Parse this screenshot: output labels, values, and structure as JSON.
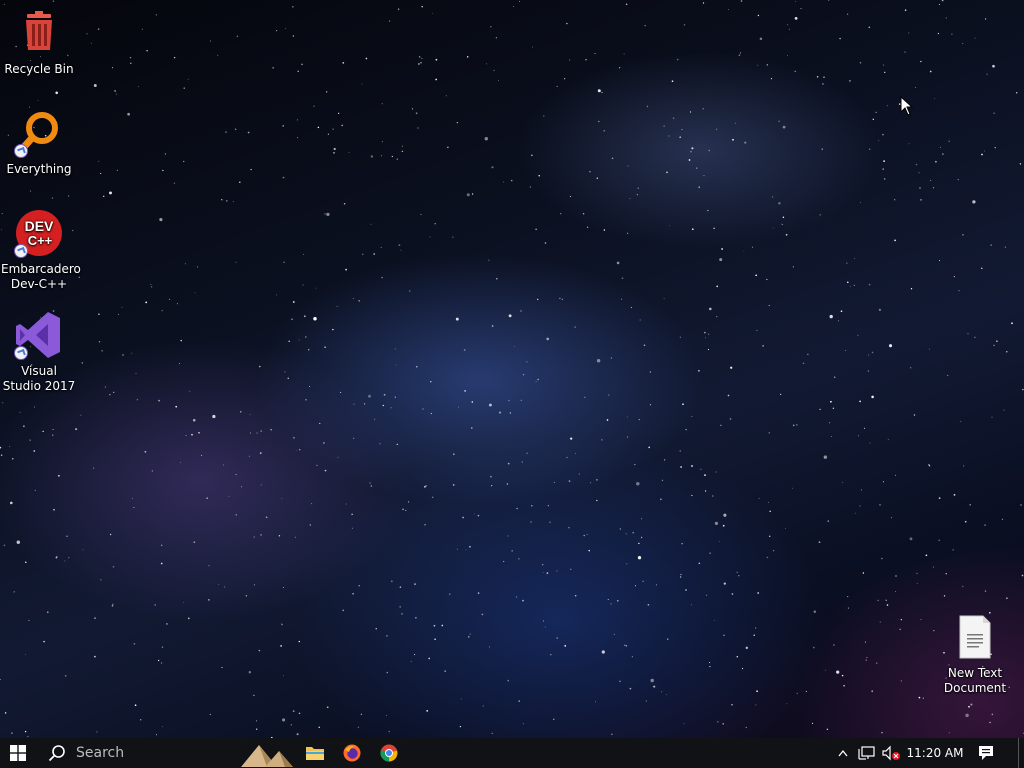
{
  "desktop": {
    "icons": [
      {
        "label": "Recycle Bin"
      },
      {
        "label": "Everything"
      },
      {
        "label": "Embarcadero Dev-C++"
      },
      {
        "label": "Visual Studio 2017"
      },
      {
        "label": "New Text Document"
      }
    ]
  },
  "taskbar": {
    "search_placeholder": "Search",
    "pinned": [
      {
        "name": "pyramids-app"
      },
      {
        "name": "file-explorer"
      },
      {
        "name": "firefox"
      },
      {
        "name": "chrome"
      }
    ],
    "tray": {
      "clock": "11:20 AM",
      "volume_muted": true
    }
  },
  "colors": {
    "taskbar_bg": "#101216",
    "recycle_red": "#e04a3a",
    "everything_orange": "#f08a10",
    "devcpp_red": "#d42020",
    "vs_purple": "#8a5ad8"
  }
}
